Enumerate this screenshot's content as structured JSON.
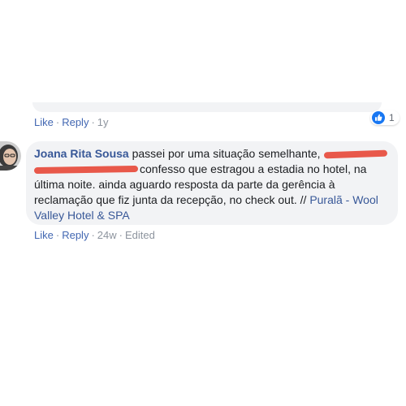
{
  "previous_comment": {
    "like_label": "Like",
    "reply_label": "Reply",
    "separator": "·",
    "time": "1y",
    "reaction_count": "1"
  },
  "comment": {
    "author": "Joana Rita Sousa",
    "text_part1": "passei por uma situação semelhante,",
    "text_part2": "confesso que estragou a estadia no hotel, na última noite. ainda aguardo resposta da parte da gerência à reclamação que fiz junta da recepção, no check out. // ",
    "tag": "Puralã - Wool Valley Hotel & SPA",
    "like_label": "Like",
    "reply_label": "Reply",
    "separator": "·",
    "time": "24w",
    "edited_label": "Edited"
  },
  "colors": {
    "link": "#4267b2",
    "author": "#385898",
    "bubble": "#f2f3f5",
    "meta": "#8d949e",
    "redaction": "#e8584a"
  }
}
